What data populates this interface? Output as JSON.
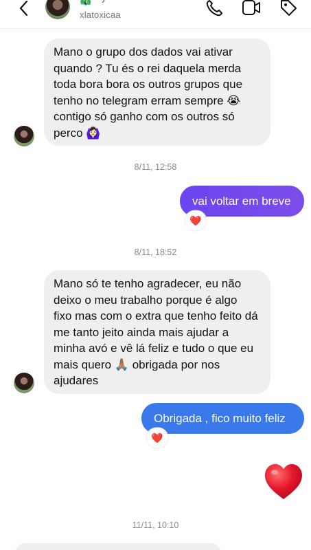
{
  "header": {
    "username": "xlatoxicaa",
    "emoji": "🦚",
    "chevron": "›",
    "icons": [
      "back-icon",
      "phone-icon",
      "video-icon",
      "tag-icon"
    ]
  },
  "messages": [
    {
      "type": "in",
      "text": "Mano o grupo dos dados vai ativar quando ? Tu és o rei daquela merda toda bora bora os outros grupos que tenho no telegram erram sempre 😭 contigo só ganho com os outros só perco 🙆🏻‍♀️"
    },
    {
      "type": "timestamp",
      "text": "8/11, 12:58"
    },
    {
      "type": "out",
      "text": "vai voltar em breve",
      "reaction": "❤️"
    },
    {
      "type": "timestamp",
      "text": "8/11, 18:52"
    },
    {
      "type": "in",
      "text": "Mano só te tenho agradecer, eu não deixo o meu trabalho porque é algo fixo mas com o extra que tenho feito dá me tanto jeito ainda mais ajudar a minha avó e vê lá feliz e tudo o que eu mais quero 🙏🏽 obrigada por nos ajudares"
    },
    {
      "type": "out",
      "text": "Obrigada , fico muito feliz",
      "reaction": "❤️"
    },
    {
      "type": "sticker",
      "text": "big-heart"
    },
    {
      "type": "timestamp",
      "text": "11/11, 10:10"
    }
  ],
  "colors": {
    "incoming_bubble": "#efefef",
    "outgoing_purple": "#6a45f0",
    "outgoing_blue": "#3a79ea",
    "heart": "#e8213c"
  }
}
